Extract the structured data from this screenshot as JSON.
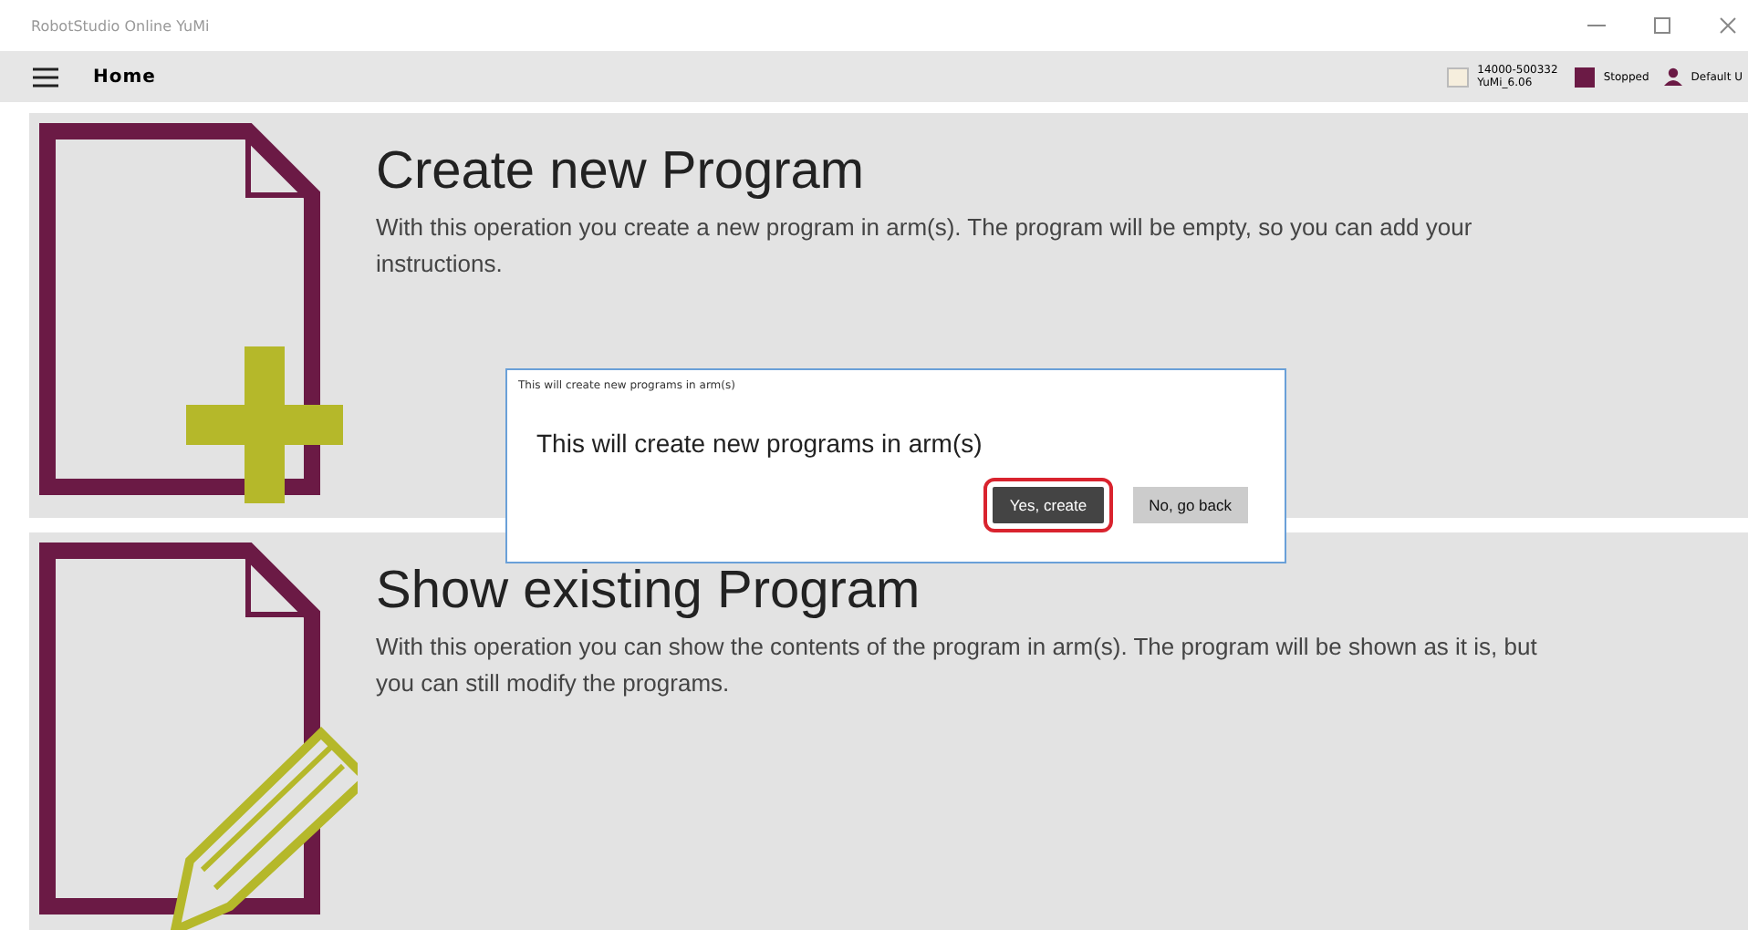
{
  "window": {
    "title": "RobotStudio Online YuMi"
  },
  "header": {
    "title": "Home",
    "controller_id": "14000-500332",
    "controller_name": "YuMi_6.06",
    "state": "Stopped",
    "user": "Default U"
  },
  "cards": [
    {
      "kind": "create",
      "title": "Create new Program",
      "description": "With this operation you create a new program in arm(s). The program will be empty, so you can add your instructions."
    },
    {
      "kind": "show",
      "title": "Show existing Program",
      "description": "With this operation you can show the contents of the program in arm(s). The program will be shown as it is, but you can still modify the programs."
    }
  ],
  "dialog": {
    "title": "This will create new programs in arm(s)",
    "message": "This will create new programs in arm(s)",
    "buttons": [
      {
        "label": "Yes, create",
        "kind": "primary",
        "highlighted": true
      },
      {
        "label": "No, go back",
        "kind": "secondary",
        "highlighted": false
      }
    ]
  }
}
